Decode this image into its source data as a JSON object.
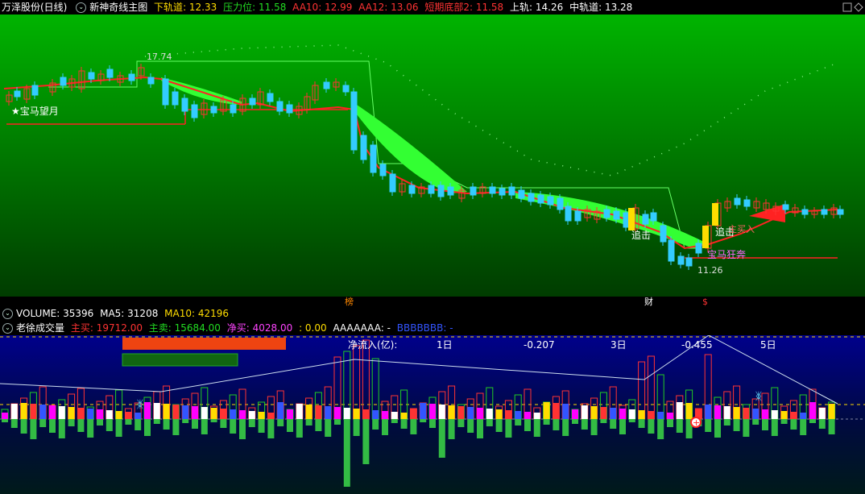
{
  "header": {
    "stock_name": "万泽股份(日线)",
    "indicator_name": "新神奇线主图",
    "items": [
      {
        "label": "下轨道",
        "value": "12.33",
        "color": "#ffdd00"
      },
      {
        "label": "压力位",
        "value": "11.58",
        "color": "#22dd22"
      },
      {
        "label": "AA10",
        "value": "12.99",
        "color": "#ff3333"
      },
      {
        "label": "AA12",
        "value": "13.06",
        "color": "#ff3333"
      },
      {
        "label": "短期底部2",
        "value": "11.58",
        "color": "#ff3333"
      },
      {
        "label": "上轨",
        "value": "14.26",
        "color": "#ffffff"
      },
      {
        "label": "中轨道",
        "value": "13.28",
        "color": "#ffffff"
      }
    ]
  },
  "main_chart": {
    "high_label": "17.74",
    "low_label": "11.26",
    "annotations": [
      "★宝马望月",
      "追击",
      "追击",
      "主买入",
      "宝马狂奔"
    ],
    "bottom_marks": [
      "榜",
      "财",
      "$"
    ]
  },
  "volume_bar": {
    "label_volume": "VOLUME: 35396",
    "label_ma5": "MA5: 31208",
    "label_ma10": "MA10: 42196"
  },
  "lower_indicator": {
    "name": "老徐成交量",
    "zhumai": "主买: 19712.00",
    "zhumai2": "主卖: 15684.00",
    "jingmai": "净买: 4028.00",
    "zero": ": 0.00",
    "aaa": "AAAAAAA: -",
    "bbb": "BBBBBBB: -",
    "net_inflow_label": "净流入(亿):",
    "periods": [
      {
        "label": "1日",
        "value": "-0.207"
      },
      {
        "label": "3日",
        "value": "-0.455"
      },
      {
        "label": "5日",
        "value": ""
      }
    ]
  },
  "colors": {
    "up": "#ff3333",
    "down": "#33ccff",
    "main_bg_top": "#00b400",
    "main_bg_bottom": "#003c00",
    "lower_bg_top": "#00008c",
    "lower_bg_bottom": "#001a1a"
  }
}
